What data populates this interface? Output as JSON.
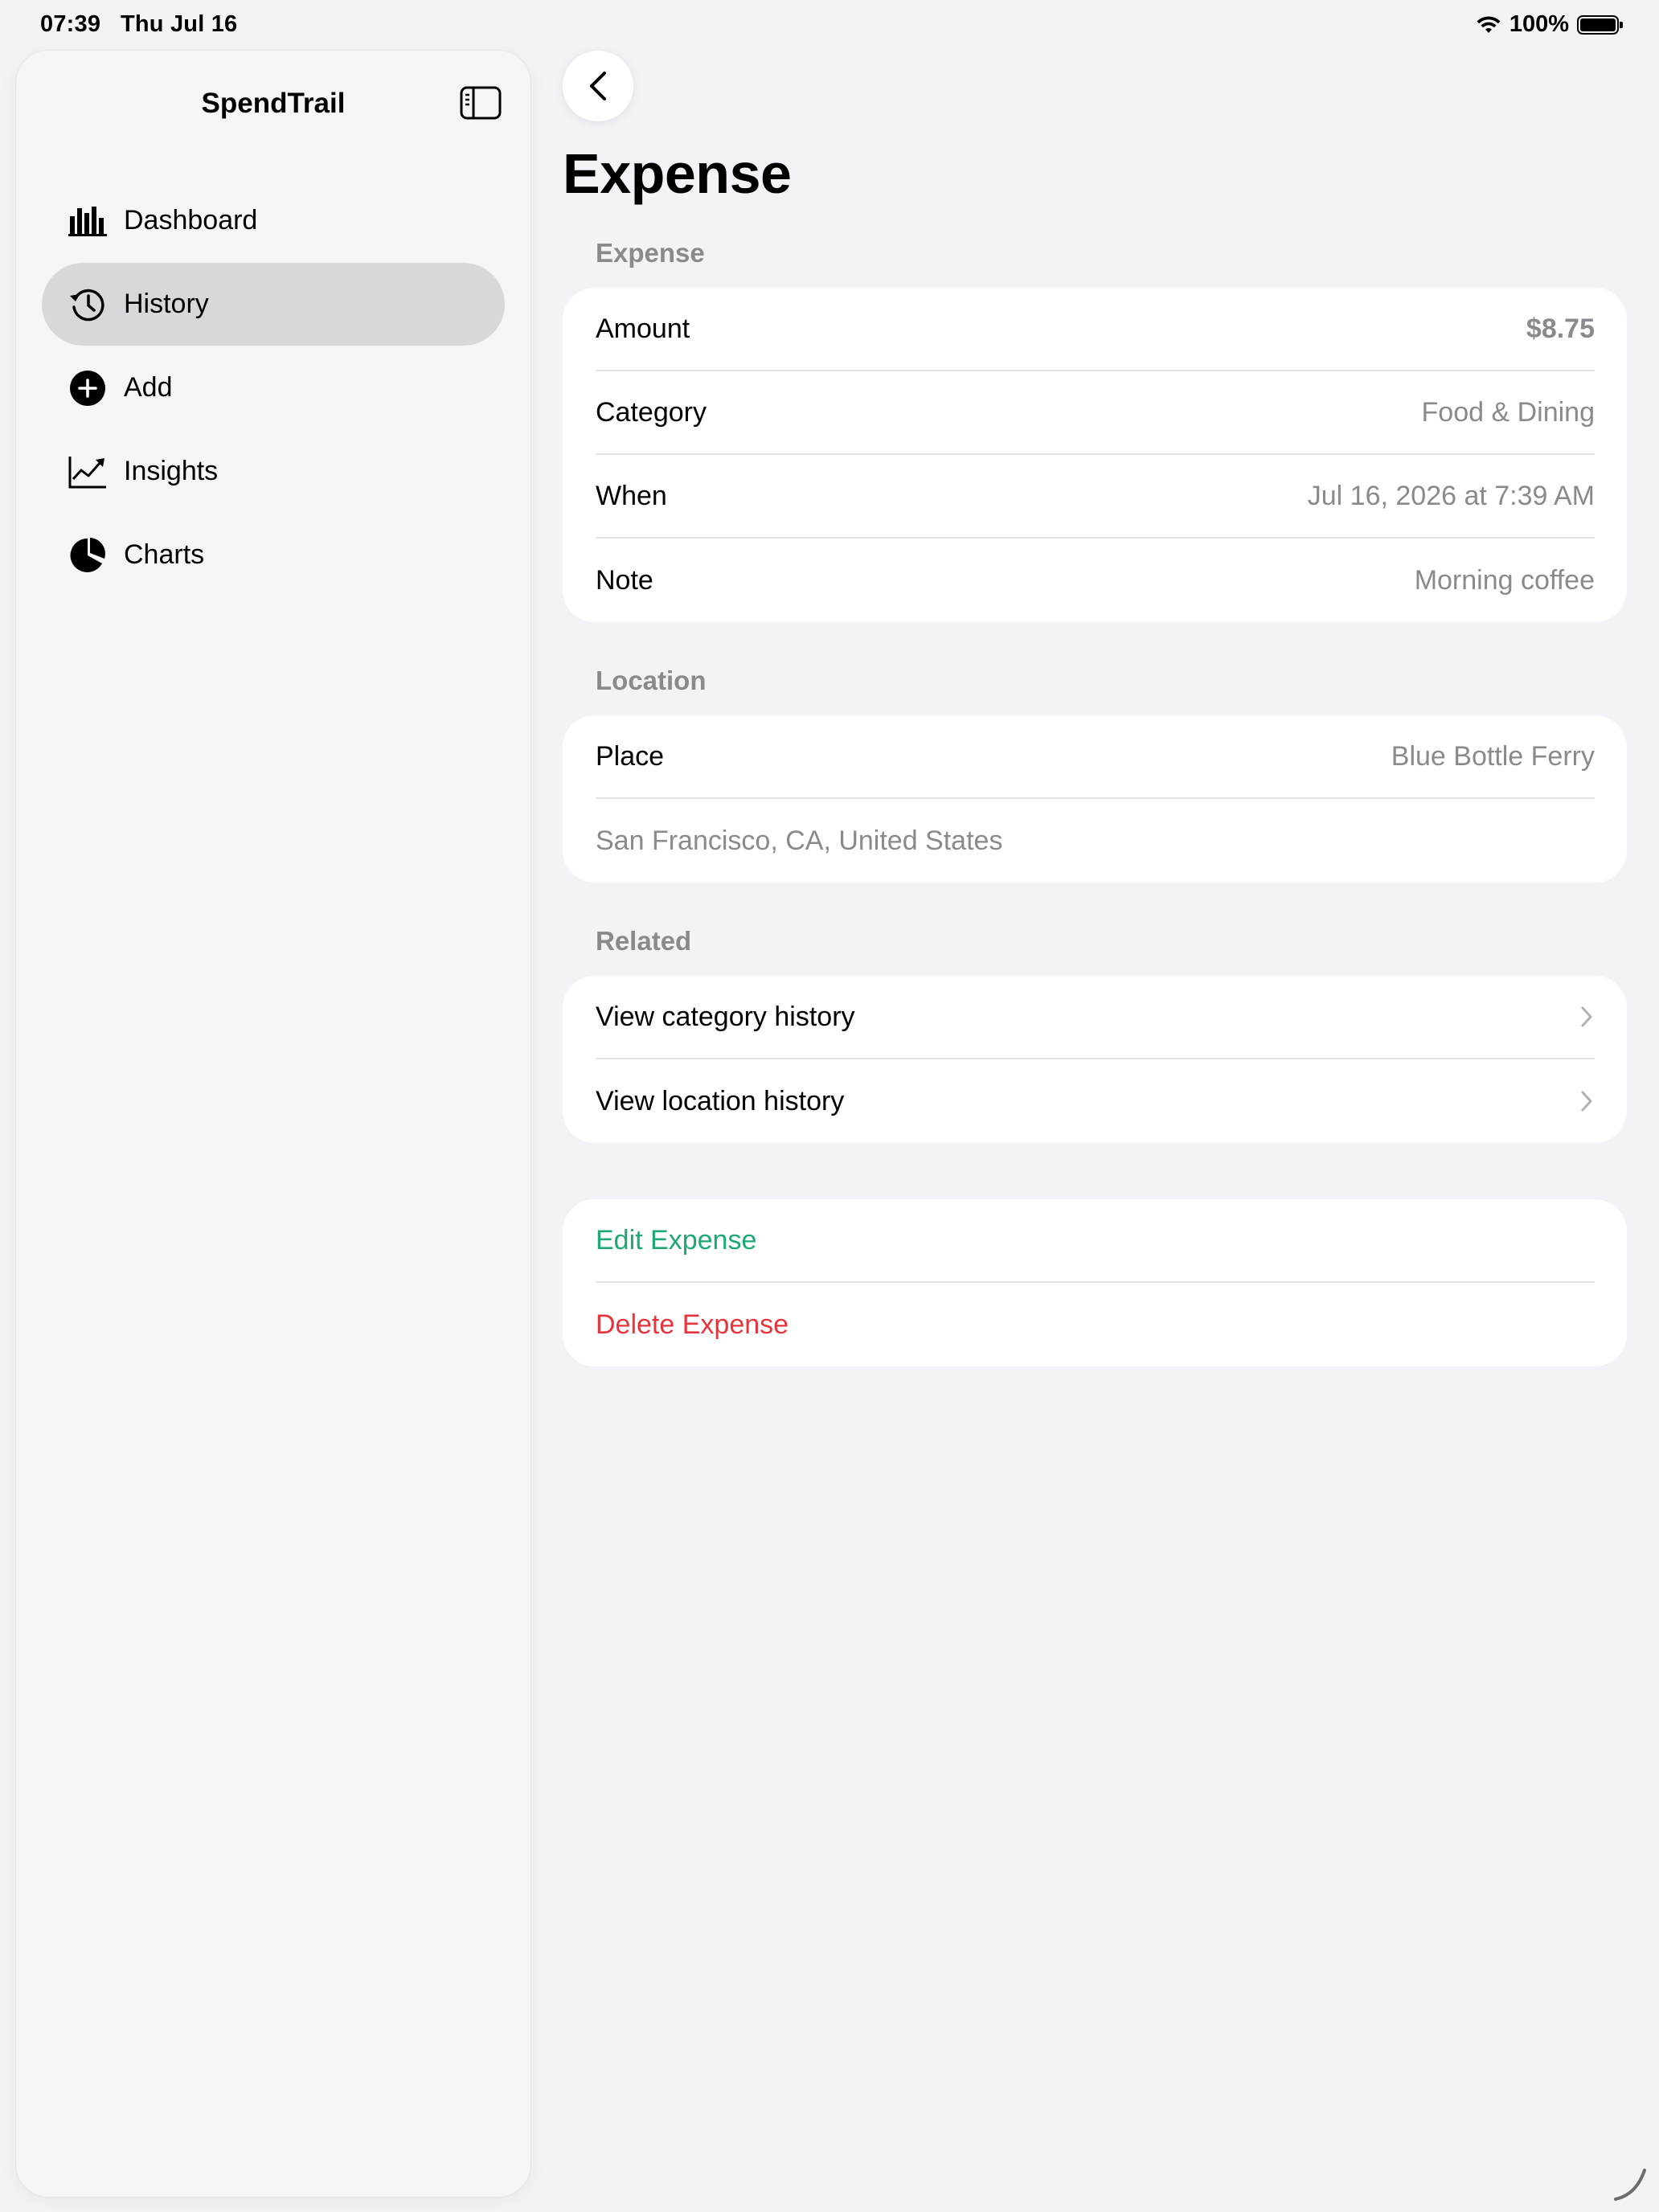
{
  "status_bar": {
    "time": "07:39",
    "date": "Thu Jul 16",
    "battery": "100%",
    "battery_level": 1.0
  },
  "sidebar": {
    "title": "SpendTrail",
    "toggle_icon": "sidebar-toggle-icon",
    "items": [
      {
        "label": "Dashboard",
        "icon": "bar-chart-icon",
        "selected": false
      },
      {
        "label": "History",
        "icon": "clock-history-icon",
        "selected": true
      },
      {
        "label": "Add",
        "icon": "plus-circle-icon",
        "selected": false
      },
      {
        "label": "Insights",
        "icon": "line-chart-icon",
        "selected": false
      },
      {
        "label": "Charts",
        "icon": "pie-chart-icon",
        "selected": false
      }
    ]
  },
  "main": {
    "title": "Expense",
    "expense_section": {
      "header": "Expense",
      "rows": [
        {
          "label": "Amount",
          "value": "$8.75"
        },
        {
          "label": "Category",
          "value": "Food & Dining"
        },
        {
          "label": "When",
          "value": "Jul 16, 2026 at 7:39 AM"
        },
        {
          "label": "Note",
          "value": "Morning coffee"
        }
      ]
    },
    "location_section": {
      "header": "Location",
      "place_label": "Place",
      "place_value": "Blue Bottle Ferry",
      "address": "San Francisco, CA, United States"
    },
    "related_section": {
      "header": "Related",
      "items": [
        "View category history",
        "View location history"
      ]
    },
    "actions": {
      "edit": "Edit Expense",
      "delete": "Delete Expense"
    }
  },
  "colors": {
    "accent_green": "#1ea874",
    "destructive_red": "#e8343c",
    "selected_bg": "#d8d8dc",
    "background": "#f2f2f7"
  }
}
